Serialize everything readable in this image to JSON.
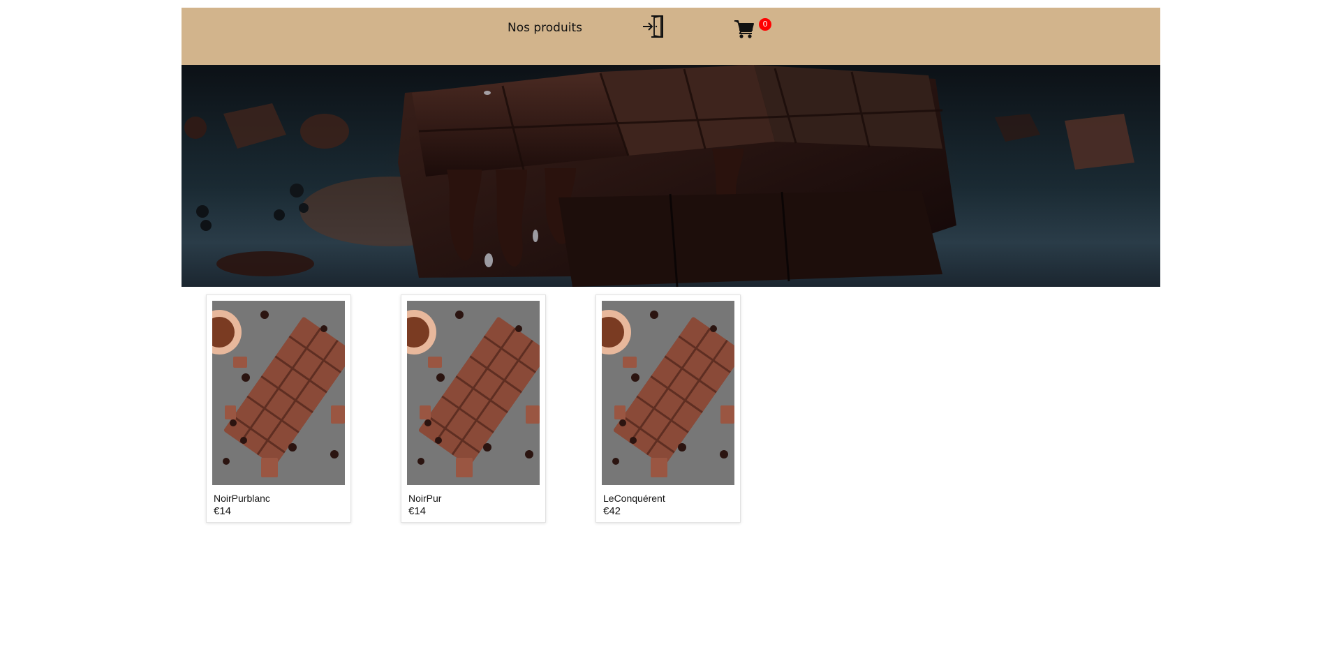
{
  "header": {
    "nav_label": "Nos produits",
    "login_icon": "login-icon",
    "cart_icon": "cart-icon",
    "cart_count": "0",
    "background_color": "#d2b48c",
    "badge_color": "#ff0000"
  },
  "banner": {
    "image": "chocolate-bars-banner"
  },
  "products": [
    {
      "name": "NoirPurblanc",
      "price": "€14"
    },
    {
      "name": "NoirPur",
      "price": "€14"
    },
    {
      "name": "LeConquérent",
      "price": "€42"
    }
  ]
}
